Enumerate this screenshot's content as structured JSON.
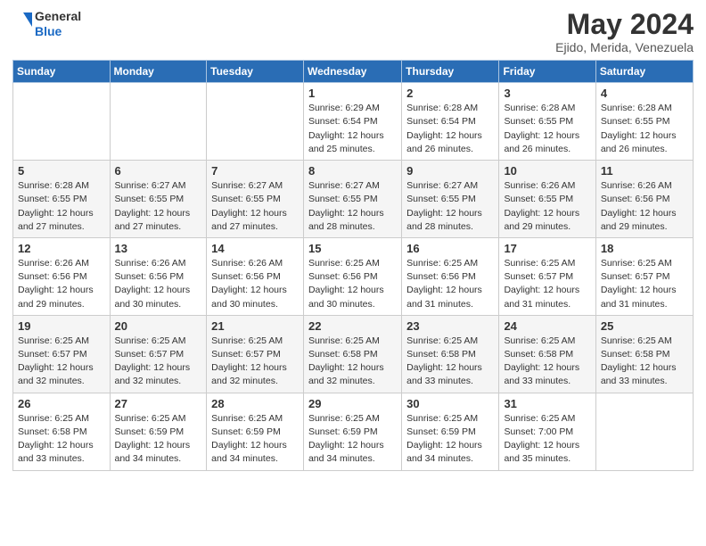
{
  "logo": {
    "general": "General",
    "blue": "Blue"
  },
  "title": "May 2024",
  "location": "Ejido, Merida, Venezuela",
  "days_of_week": [
    "Sunday",
    "Monday",
    "Tuesday",
    "Wednesday",
    "Thursday",
    "Friday",
    "Saturday"
  ],
  "weeks": [
    [
      {
        "day": "",
        "info": ""
      },
      {
        "day": "",
        "info": ""
      },
      {
        "day": "",
        "info": ""
      },
      {
        "day": "1",
        "info": "Sunrise: 6:29 AM\nSunset: 6:54 PM\nDaylight: 12 hours and 25 minutes."
      },
      {
        "day": "2",
        "info": "Sunrise: 6:28 AM\nSunset: 6:54 PM\nDaylight: 12 hours and 26 minutes."
      },
      {
        "day": "3",
        "info": "Sunrise: 6:28 AM\nSunset: 6:55 PM\nDaylight: 12 hours and 26 minutes."
      },
      {
        "day": "4",
        "info": "Sunrise: 6:28 AM\nSunset: 6:55 PM\nDaylight: 12 hours and 26 minutes."
      }
    ],
    [
      {
        "day": "5",
        "info": "Sunrise: 6:28 AM\nSunset: 6:55 PM\nDaylight: 12 hours and 27 minutes."
      },
      {
        "day": "6",
        "info": "Sunrise: 6:27 AM\nSunset: 6:55 PM\nDaylight: 12 hours and 27 minutes."
      },
      {
        "day": "7",
        "info": "Sunrise: 6:27 AM\nSunset: 6:55 PM\nDaylight: 12 hours and 27 minutes."
      },
      {
        "day": "8",
        "info": "Sunrise: 6:27 AM\nSunset: 6:55 PM\nDaylight: 12 hours and 28 minutes."
      },
      {
        "day": "9",
        "info": "Sunrise: 6:27 AM\nSunset: 6:55 PM\nDaylight: 12 hours and 28 minutes."
      },
      {
        "day": "10",
        "info": "Sunrise: 6:26 AM\nSunset: 6:55 PM\nDaylight: 12 hours and 29 minutes."
      },
      {
        "day": "11",
        "info": "Sunrise: 6:26 AM\nSunset: 6:56 PM\nDaylight: 12 hours and 29 minutes."
      }
    ],
    [
      {
        "day": "12",
        "info": "Sunrise: 6:26 AM\nSunset: 6:56 PM\nDaylight: 12 hours and 29 minutes."
      },
      {
        "day": "13",
        "info": "Sunrise: 6:26 AM\nSunset: 6:56 PM\nDaylight: 12 hours and 30 minutes."
      },
      {
        "day": "14",
        "info": "Sunrise: 6:26 AM\nSunset: 6:56 PM\nDaylight: 12 hours and 30 minutes."
      },
      {
        "day": "15",
        "info": "Sunrise: 6:25 AM\nSunset: 6:56 PM\nDaylight: 12 hours and 30 minutes."
      },
      {
        "day": "16",
        "info": "Sunrise: 6:25 AM\nSunset: 6:56 PM\nDaylight: 12 hours and 31 minutes."
      },
      {
        "day": "17",
        "info": "Sunrise: 6:25 AM\nSunset: 6:57 PM\nDaylight: 12 hours and 31 minutes."
      },
      {
        "day": "18",
        "info": "Sunrise: 6:25 AM\nSunset: 6:57 PM\nDaylight: 12 hours and 31 minutes."
      }
    ],
    [
      {
        "day": "19",
        "info": "Sunrise: 6:25 AM\nSunset: 6:57 PM\nDaylight: 12 hours and 32 minutes."
      },
      {
        "day": "20",
        "info": "Sunrise: 6:25 AM\nSunset: 6:57 PM\nDaylight: 12 hours and 32 minutes."
      },
      {
        "day": "21",
        "info": "Sunrise: 6:25 AM\nSunset: 6:57 PM\nDaylight: 12 hours and 32 minutes."
      },
      {
        "day": "22",
        "info": "Sunrise: 6:25 AM\nSunset: 6:58 PM\nDaylight: 12 hours and 32 minutes."
      },
      {
        "day": "23",
        "info": "Sunrise: 6:25 AM\nSunset: 6:58 PM\nDaylight: 12 hours and 33 minutes."
      },
      {
        "day": "24",
        "info": "Sunrise: 6:25 AM\nSunset: 6:58 PM\nDaylight: 12 hours and 33 minutes."
      },
      {
        "day": "25",
        "info": "Sunrise: 6:25 AM\nSunset: 6:58 PM\nDaylight: 12 hours and 33 minutes."
      }
    ],
    [
      {
        "day": "26",
        "info": "Sunrise: 6:25 AM\nSunset: 6:58 PM\nDaylight: 12 hours and 33 minutes."
      },
      {
        "day": "27",
        "info": "Sunrise: 6:25 AM\nSunset: 6:59 PM\nDaylight: 12 hours and 34 minutes."
      },
      {
        "day": "28",
        "info": "Sunrise: 6:25 AM\nSunset: 6:59 PM\nDaylight: 12 hours and 34 minutes."
      },
      {
        "day": "29",
        "info": "Sunrise: 6:25 AM\nSunset: 6:59 PM\nDaylight: 12 hours and 34 minutes."
      },
      {
        "day": "30",
        "info": "Sunrise: 6:25 AM\nSunset: 6:59 PM\nDaylight: 12 hours and 34 minutes."
      },
      {
        "day": "31",
        "info": "Sunrise: 6:25 AM\nSunset: 7:00 PM\nDaylight: 12 hours and 35 minutes."
      },
      {
        "day": "",
        "info": ""
      }
    ]
  ]
}
